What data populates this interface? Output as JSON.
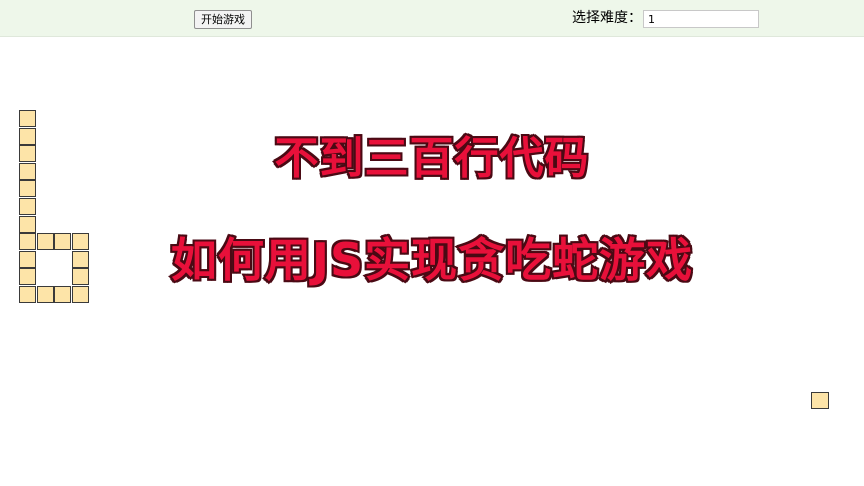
{
  "toolbar": {
    "start_button_label": "开始游戏",
    "difficulty_label": "选择难度：",
    "difficulty_value": "1"
  },
  "overlay": {
    "line1": "不到三百行代码",
    "line2": "如何用JS实现贪吃蛇游戏"
  },
  "colors": {
    "toolbar_bg": "#eef7ea",
    "cell_fill": "#fde4a8",
    "cell_border": "#3a3a3a",
    "title_fill": "#e8103a",
    "title_stroke": "#4a0a14"
  },
  "game": {
    "snake_cells": [
      [
        0,
        0
      ],
      [
        0,
        1
      ],
      [
        0,
        2
      ],
      [
        0,
        3
      ],
      [
        0,
        4
      ],
      [
        0,
        5
      ],
      [
        0,
        6
      ],
      [
        0,
        7
      ],
      [
        1,
        7
      ],
      [
        2,
        7
      ],
      [
        3,
        7
      ],
      [
        3,
        8
      ],
      [
        3,
        9
      ],
      [
        3,
        10
      ],
      [
        2,
        10
      ],
      [
        1,
        10
      ],
      [
        0,
        10
      ],
      [
        0,
        9
      ],
      [
        0,
        8
      ]
    ],
    "food_cell": [
      45,
      16
    ]
  }
}
